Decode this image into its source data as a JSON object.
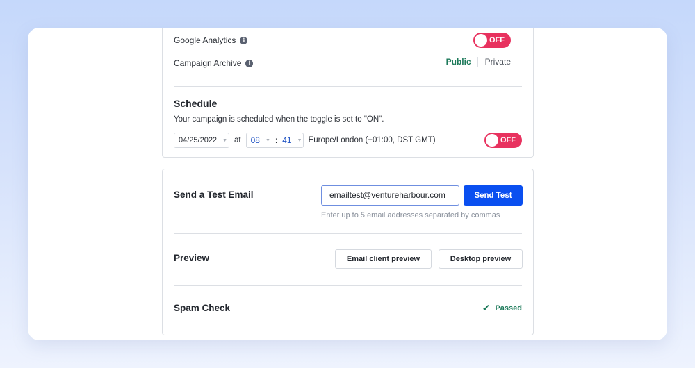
{
  "settings": {
    "google_analytics": {
      "label": "Google Analytics",
      "toggle_state": "OFF"
    },
    "campaign_archive": {
      "label": "Campaign Archive",
      "options": [
        "Public",
        "Private"
      ],
      "selected": "Public"
    }
  },
  "schedule": {
    "title": "Schedule",
    "description": "Your campaign is scheduled when the toggle is set to \"ON\".",
    "date": "04/25/2022",
    "at_label": "at",
    "hour": "08",
    "separator": ":",
    "minute": "41",
    "timezone": "Europe/London (+01:00, DST GMT)",
    "toggle_state": "OFF"
  },
  "test_email": {
    "title": "Send a Test Email",
    "input_value": "emailtest@ventureharbour.com",
    "button_label": "Send Test",
    "hint": "Enter up to 5 email addresses separated by commas"
  },
  "preview": {
    "title": "Preview",
    "buttons": [
      "Email client preview",
      "Desktop preview"
    ]
  },
  "spam_check": {
    "title": "Spam Check",
    "status": "Passed",
    "status_icon": "checkmark-icon"
  },
  "colors": {
    "toggle_off": "#e8325f",
    "primary": "#0a4ff0",
    "success": "#1d7a5a",
    "background_top": "#c5d8fb",
    "background_bottom": "#eef3fe"
  }
}
